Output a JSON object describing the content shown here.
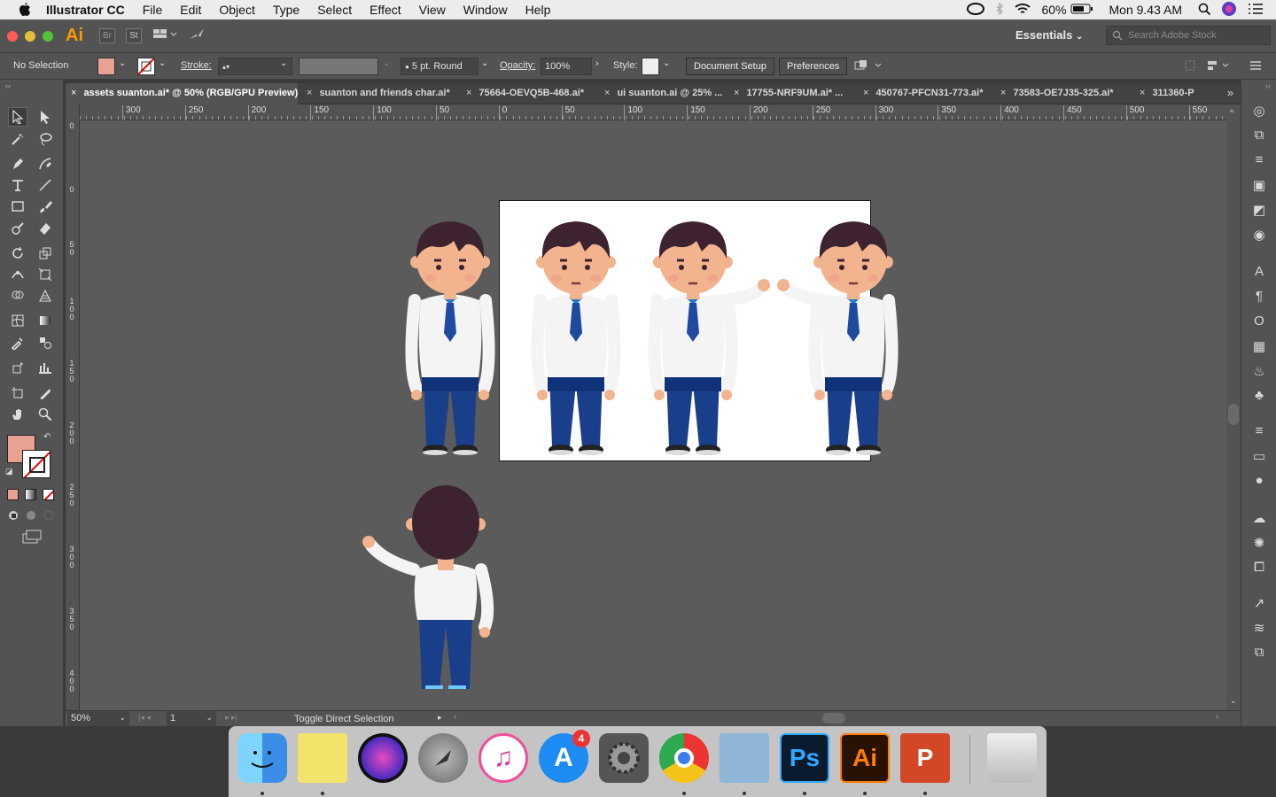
{
  "menubar": {
    "app_name": "Illustrator CC",
    "menus": [
      "File",
      "Edit",
      "Object",
      "Type",
      "Select",
      "Effect",
      "View",
      "Window",
      "Help"
    ],
    "battery": "60%",
    "clock": "Mon 9.43 AM"
  },
  "titlebar": {
    "app_logo": "Ai",
    "bridge": "Br",
    "stock": "St",
    "workspace": "Essentials",
    "search_placeholder": "Search Adobe Stock"
  },
  "control": {
    "selection": "No Selection",
    "stroke_label": "Stroke:",
    "brush": "5 pt. Round",
    "opacity_label": "Opacity:",
    "opacity_value": "100%",
    "style_label": "Style:",
    "doc_setup": "Document Setup",
    "preferences": "Preferences",
    "fill_color": "#e8a294"
  },
  "tabs": [
    {
      "label": "assets suanton.ai* @ 50% (RGB/GPU Preview)",
      "active": true
    },
    {
      "label": "suanton and friends char.ai*",
      "active": false
    },
    {
      "label": "75664-OEVQ5B-468.ai*",
      "active": false
    },
    {
      "label": "ui suanton.ai @ 25% ...",
      "active": false
    },
    {
      "label": "17755-NRF9UM.ai* ...",
      "active": false
    },
    {
      "label": "450767-PFCN31-773.ai*",
      "active": false
    },
    {
      "label": "73583-OE7J35-325.ai*",
      "active": false
    },
    {
      "label": "311360-P",
      "active": false
    }
  ],
  "ruler": {
    "h_ticks": [
      "300",
      "250",
      "200",
      "150",
      "100",
      "50",
      "0",
      "50",
      "100",
      "150",
      "200",
      "250",
      "300",
      "350",
      "400",
      "450",
      "500",
      "550"
    ],
    "v_ticks": [
      "0",
      "0",
      "5\n0",
      "1\n0\n0",
      "1\n5\n0",
      "2\n0\n0",
      "2\n5\n0",
      "3\n0\n0",
      "3\n5\n0",
      "4\n0\n0"
    ]
  },
  "status": {
    "zoom": "50%",
    "artboard_num": "1",
    "status_text": "Toggle Direct Selection"
  },
  "dock": {
    "badge_appstore": "4",
    "icons": [
      "finder-icon",
      "stickies-icon",
      "siri-icon",
      "launchpad-icon",
      "itunes-icon",
      "app-store-icon",
      "system-preferences-icon",
      "chrome-icon",
      "preview-icon",
      "photoshop-icon",
      "illustrator-icon",
      "powerpoint-icon",
      "trash-icon"
    ],
    "ps_label": "Ps",
    "ai_label": "Ai",
    "ppt_label": "P"
  },
  "colors": {
    "skin": "#f2b48f",
    "hair": "#3d2330",
    "shirt": "#f4f4f4",
    "pants": "#1a3f8a",
    "tie": "#1e4aa0"
  }
}
